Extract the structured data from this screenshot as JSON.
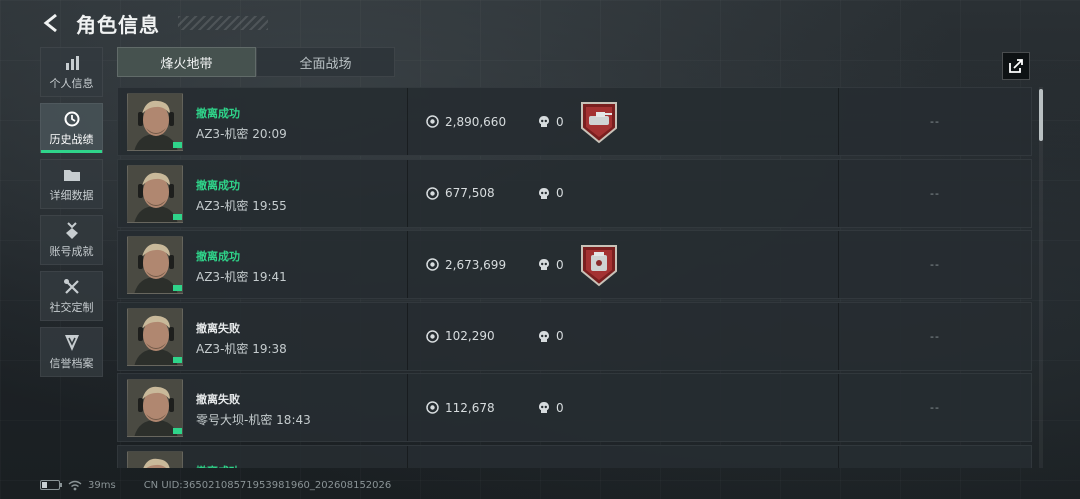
{
  "header": {
    "title": "角色信息",
    "back_icon": "chevron-left-icon"
  },
  "sidebar": {
    "items": [
      {
        "label": "个人信息",
        "icon": "bar-chart-icon",
        "active": false
      },
      {
        "label": "历史战绩",
        "icon": "clock-icon",
        "active": true
      },
      {
        "label": "详细数据",
        "icon": "folder-icon",
        "active": false
      },
      {
        "label": "账号成就",
        "icon": "medal-icon",
        "active": false
      },
      {
        "label": "社交定制",
        "icon": "tools-icon",
        "active": false
      },
      {
        "label": "信誉档案",
        "icon": "shield-icon",
        "active": false
      }
    ]
  },
  "tabs": [
    {
      "label": "烽火地带",
      "active": true
    },
    {
      "label": "全面战场",
      "active": false
    }
  ],
  "share_icon": "share-icon",
  "records": [
    {
      "status": "撤离成功",
      "success": true,
      "map": "AZ3-机密",
      "time": "20:09",
      "value": "2,890,660",
      "kills": "0",
      "badge": "tank-badge",
      "extra": "--"
    },
    {
      "status": "撤离成功",
      "success": true,
      "map": "AZ3-机密",
      "time": "19:55",
      "value": "677,508",
      "kills": "0",
      "badge": "",
      "extra": "--"
    },
    {
      "status": "撤离成功",
      "success": true,
      "map": "AZ3-机密",
      "time": "19:41",
      "value": "2,673,699",
      "kills": "0",
      "badge": "machine-badge",
      "extra": "--"
    },
    {
      "status": "撤离失败",
      "success": false,
      "map": "AZ3-机密",
      "time": "19:38",
      "value": "102,290",
      "kills": "0",
      "badge": "",
      "extra": "--"
    },
    {
      "status": "撤离失败",
      "success": false,
      "map": "零号大坝-机密",
      "time": "18:43",
      "value": "112,678",
      "kills": "0",
      "badge": "",
      "extra": "--"
    },
    {
      "status": "撤离成功",
      "success": true,
      "map": "",
      "time": "",
      "value": "",
      "kills": "",
      "badge": "",
      "extra": ""
    }
  ],
  "footer": {
    "ping": "39ms",
    "uid": "CN UID:3650210857195398196​0_202608152026"
  },
  "colors": {
    "accent_green": "#2fd48a",
    "badge_red": "#7a1f1f"
  }
}
